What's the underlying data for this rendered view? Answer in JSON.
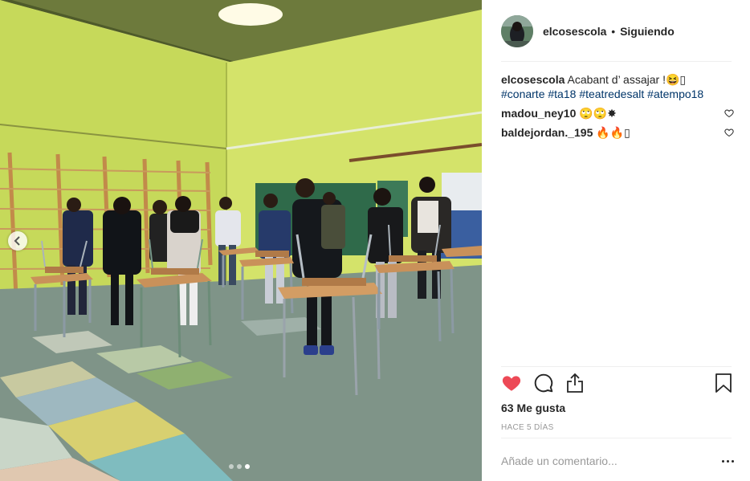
{
  "post": {
    "username": "elcosescola",
    "separator": "•",
    "follow_status": "Siguiendo",
    "caption": {
      "username": "elcosescola",
      "text": "Acabant d’ assajar !😆▯",
      "hashtags": [
        "#conarte",
        "#ta18",
        "#teatredesalt",
        "#atempo18"
      ]
    },
    "comments": [
      {
        "username": "madou_ney10",
        "text": "🙄🙄✸"
      },
      {
        "username": "baldejordan._195",
        "text": "🔥🔥▯"
      }
    ],
    "likes_label": "63 Me gusta",
    "timestamp": "HACE 5 DÍAS",
    "comment_placeholder": "Añade un comentario..."
  },
  "carousel": {
    "total": 3,
    "active_index": 2
  },
  "icons": {
    "like": "heart-filled-icon",
    "comment": "speech-bubble-icon",
    "share": "share-icon",
    "save": "bookmark-icon",
    "more": "ellipsis-icon",
    "prev": "chevron-left-icon",
    "comment_like": "heart-outline-icon"
  },
  "colors": {
    "like_red": "#ed4956",
    "hashtag_blue": "#003569",
    "meta_gray": "#999999",
    "text": "#262626",
    "wall_green": "#c9d864"
  }
}
